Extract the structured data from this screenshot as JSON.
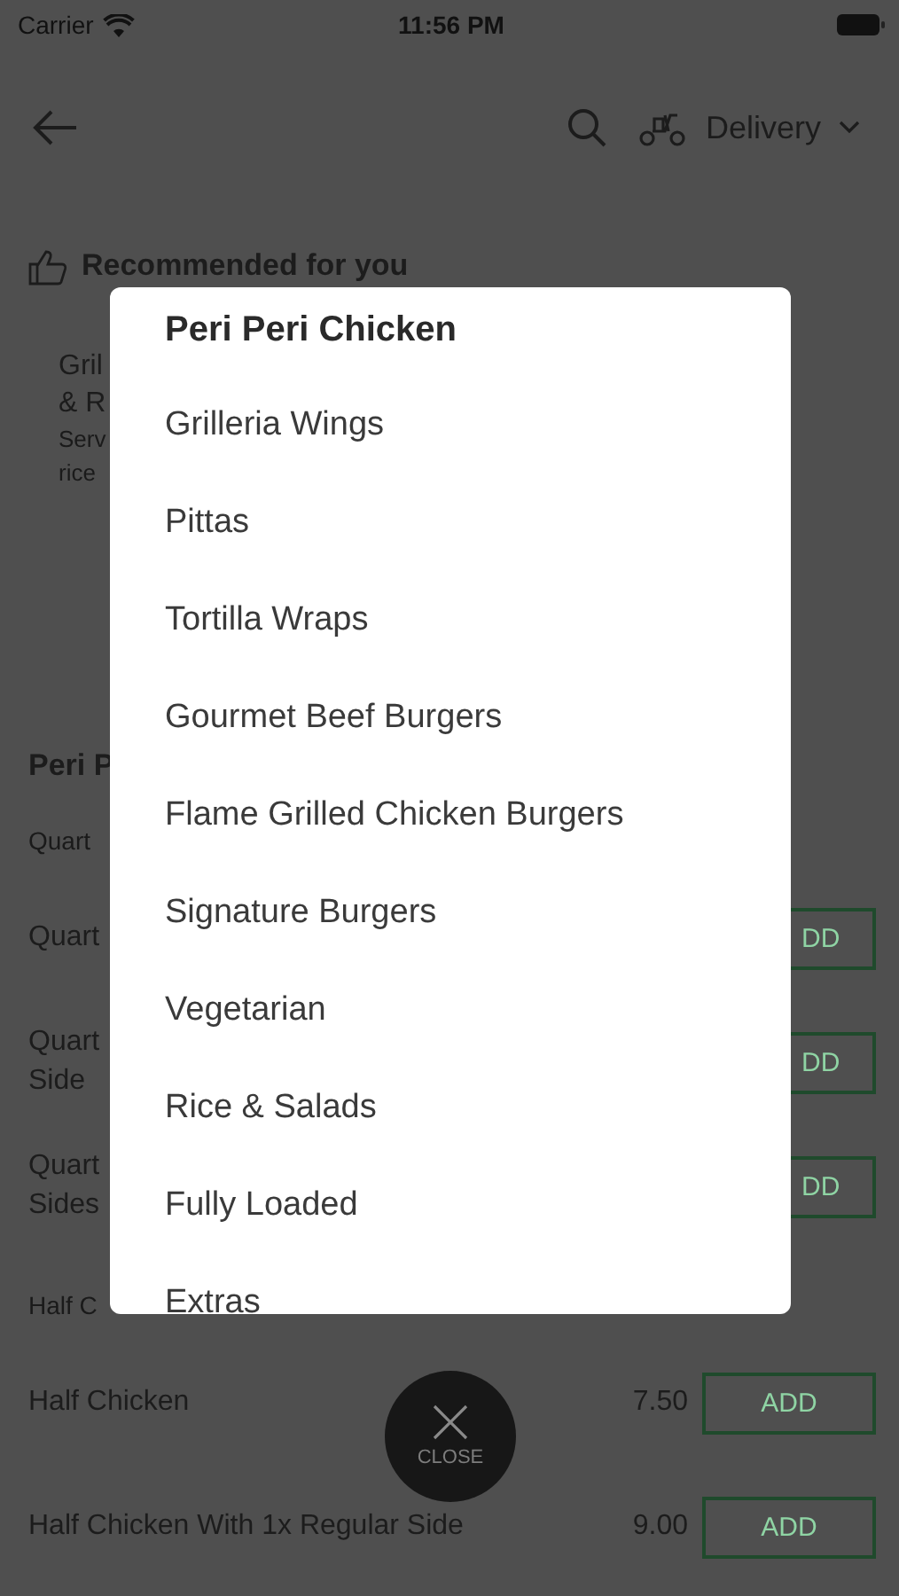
{
  "status_bar": {
    "carrier": "Carrier",
    "time": "11:56 PM"
  },
  "nav": {
    "order_mode": "Delivery"
  },
  "recommended": {
    "title": "Recommended for you",
    "item": {
      "name_parts": [
        "Gril",
        "& R"
      ],
      "description_parts": [
        "Serv",
        "rice"
      ]
    }
  },
  "menu": {
    "title": "Peri P",
    "subsections": [
      {
        "title": "Quart",
        "items": [
          {
            "name_parts": [
              "Quart"
            ],
            "add_label": "DD"
          },
          {
            "name_parts": [
              "Quart",
              "Side"
            ],
            "add_label": "DD"
          },
          {
            "name_parts": [
              "Quart",
              "Sides"
            ],
            "add_label": "DD"
          }
        ]
      },
      {
        "title": "Half C",
        "items": [
          {
            "name_parts": [
              "Half Chicken"
            ],
            "price": "7.50",
            "add_label": "ADD"
          },
          {
            "name_parts": [
              "Half Chicken With 1x Regular Side"
            ],
            "price": "9.00",
            "add_label": "ADD"
          }
        ]
      }
    ]
  },
  "category_picker": {
    "title": "Peri Peri Chicken",
    "categories": [
      "Grilleria Wings",
      "Pittas",
      "Tortilla Wraps",
      "Gourmet Beef Burgers",
      "Flame Grilled Chicken Burgers",
      "Signature Burgers",
      "Vegetarian",
      "Rice & Salads",
      "Fully Loaded",
      "Extras"
    ]
  },
  "close_button": {
    "label": "CLOSE"
  }
}
